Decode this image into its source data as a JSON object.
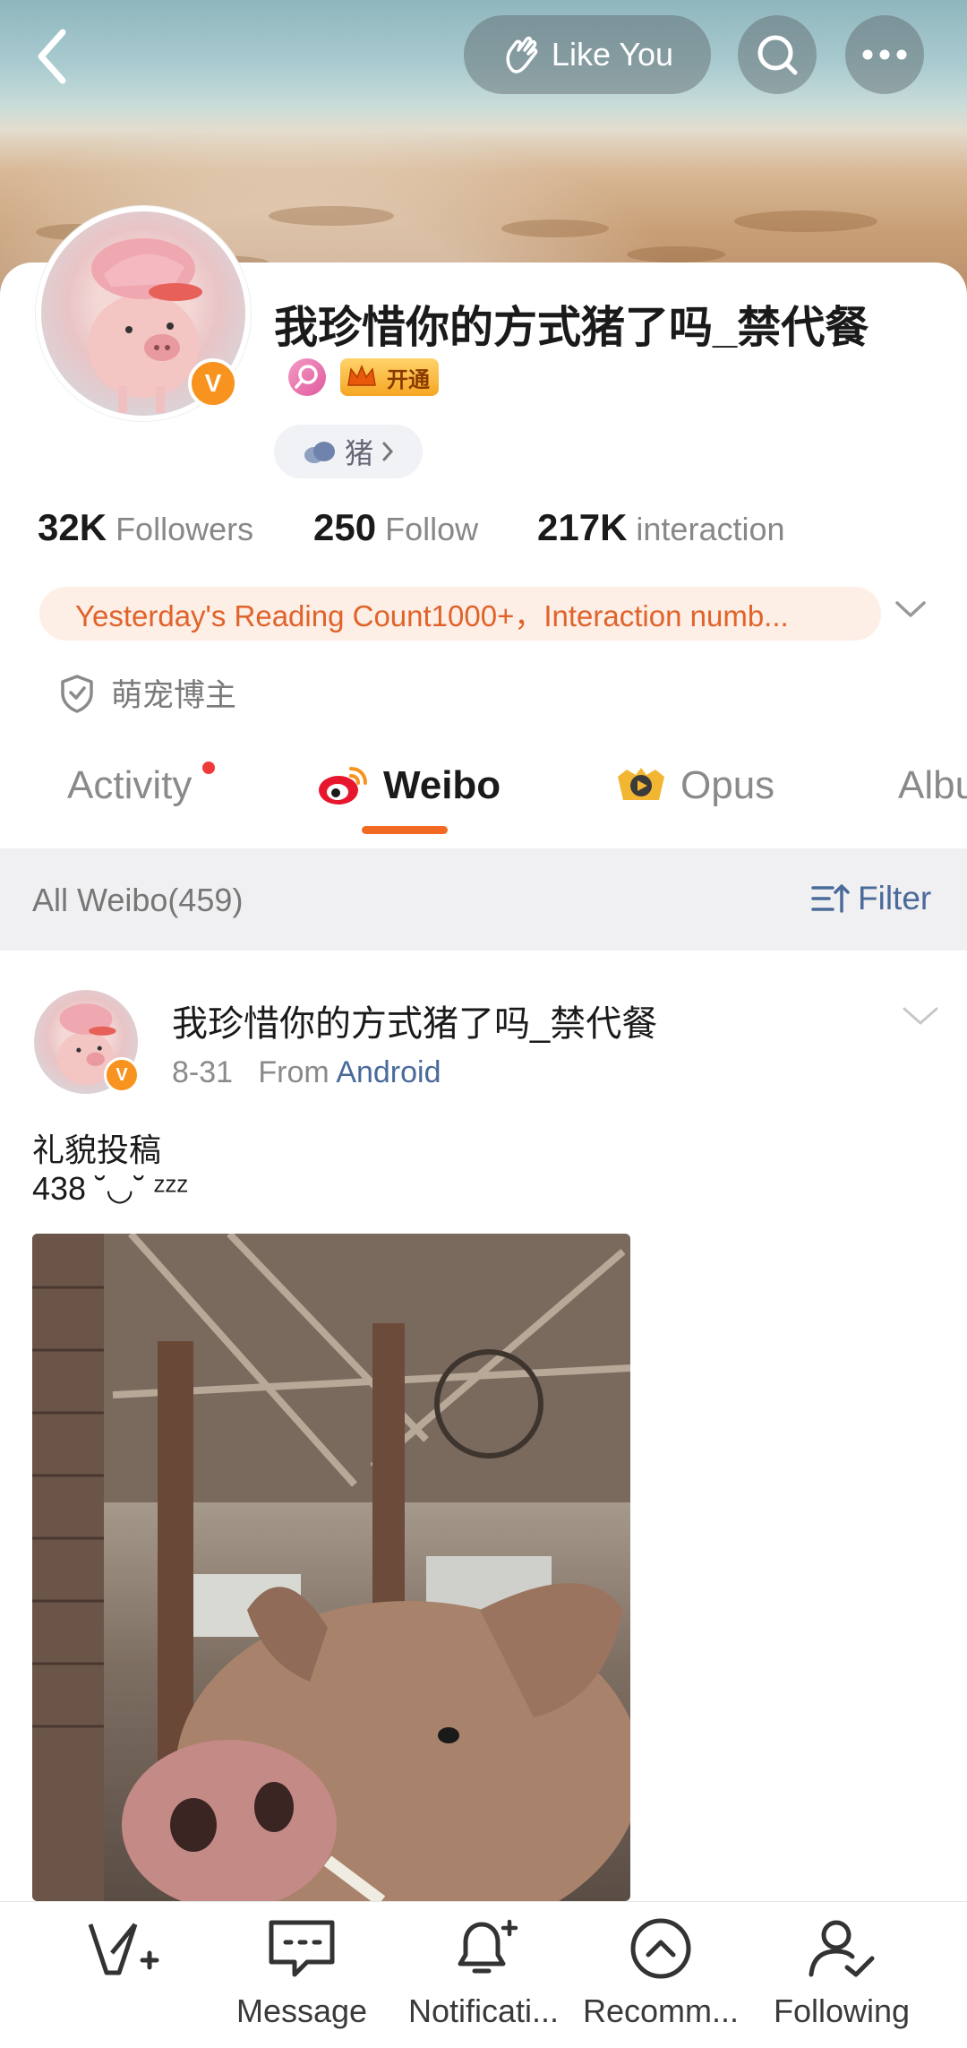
{
  "header": {
    "like_label": "Like You"
  },
  "profile": {
    "name": "我珍惜你的方式猪了吗_禁代餐",
    "verified_badge": "V",
    "vip_label": "开通",
    "tag_label": "猪",
    "stats": {
      "followers_count": "32K",
      "followers_label": "Followers",
      "follow_count": "250",
      "follow_label": "Follow",
      "interaction_count": "217K",
      "interaction_label": "interaction"
    },
    "reading_banner": "Yesterday's Reading Count1000+，Interaction numb...",
    "category_label": "萌宠博主"
  },
  "tabs": [
    {
      "label": "Activity"
    },
    {
      "label": "Weibo"
    },
    {
      "label": "Opus"
    },
    {
      "label": "Albu"
    }
  ],
  "filter_bar": {
    "all_label": "All Weibo(459)",
    "filter_label": "Filter"
  },
  "post": {
    "author": "我珍惜你的方式猪了吗_禁代餐",
    "date": "8-31",
    "from_label": "From",
    "source": "Android",
    "text_line1": "礼貌投稿",
    "text_line2": "438 ˘◡˘ ᶻᶻᶻ"
  },
  "bottom_nav": [
    {
      "label": "",
      "icon": "compose-icon"
    },
    {
      "label": "Message",
      "icon": "message-icon"
    },
    {
      "label": "Notificati...",
      "icon": "bell-icon"
    },
    {
      "label": "Recomm...",
      "icon": "chevron-up-circle-icon"
    },
    {
      "label": "Following",
      "icon": "person-check-icon"
    }
  ],
  "colors": {
    "accent": "#f26a21",
    "verified": "#f7931e",
    "link": "#4a6a9a"
  }
}
